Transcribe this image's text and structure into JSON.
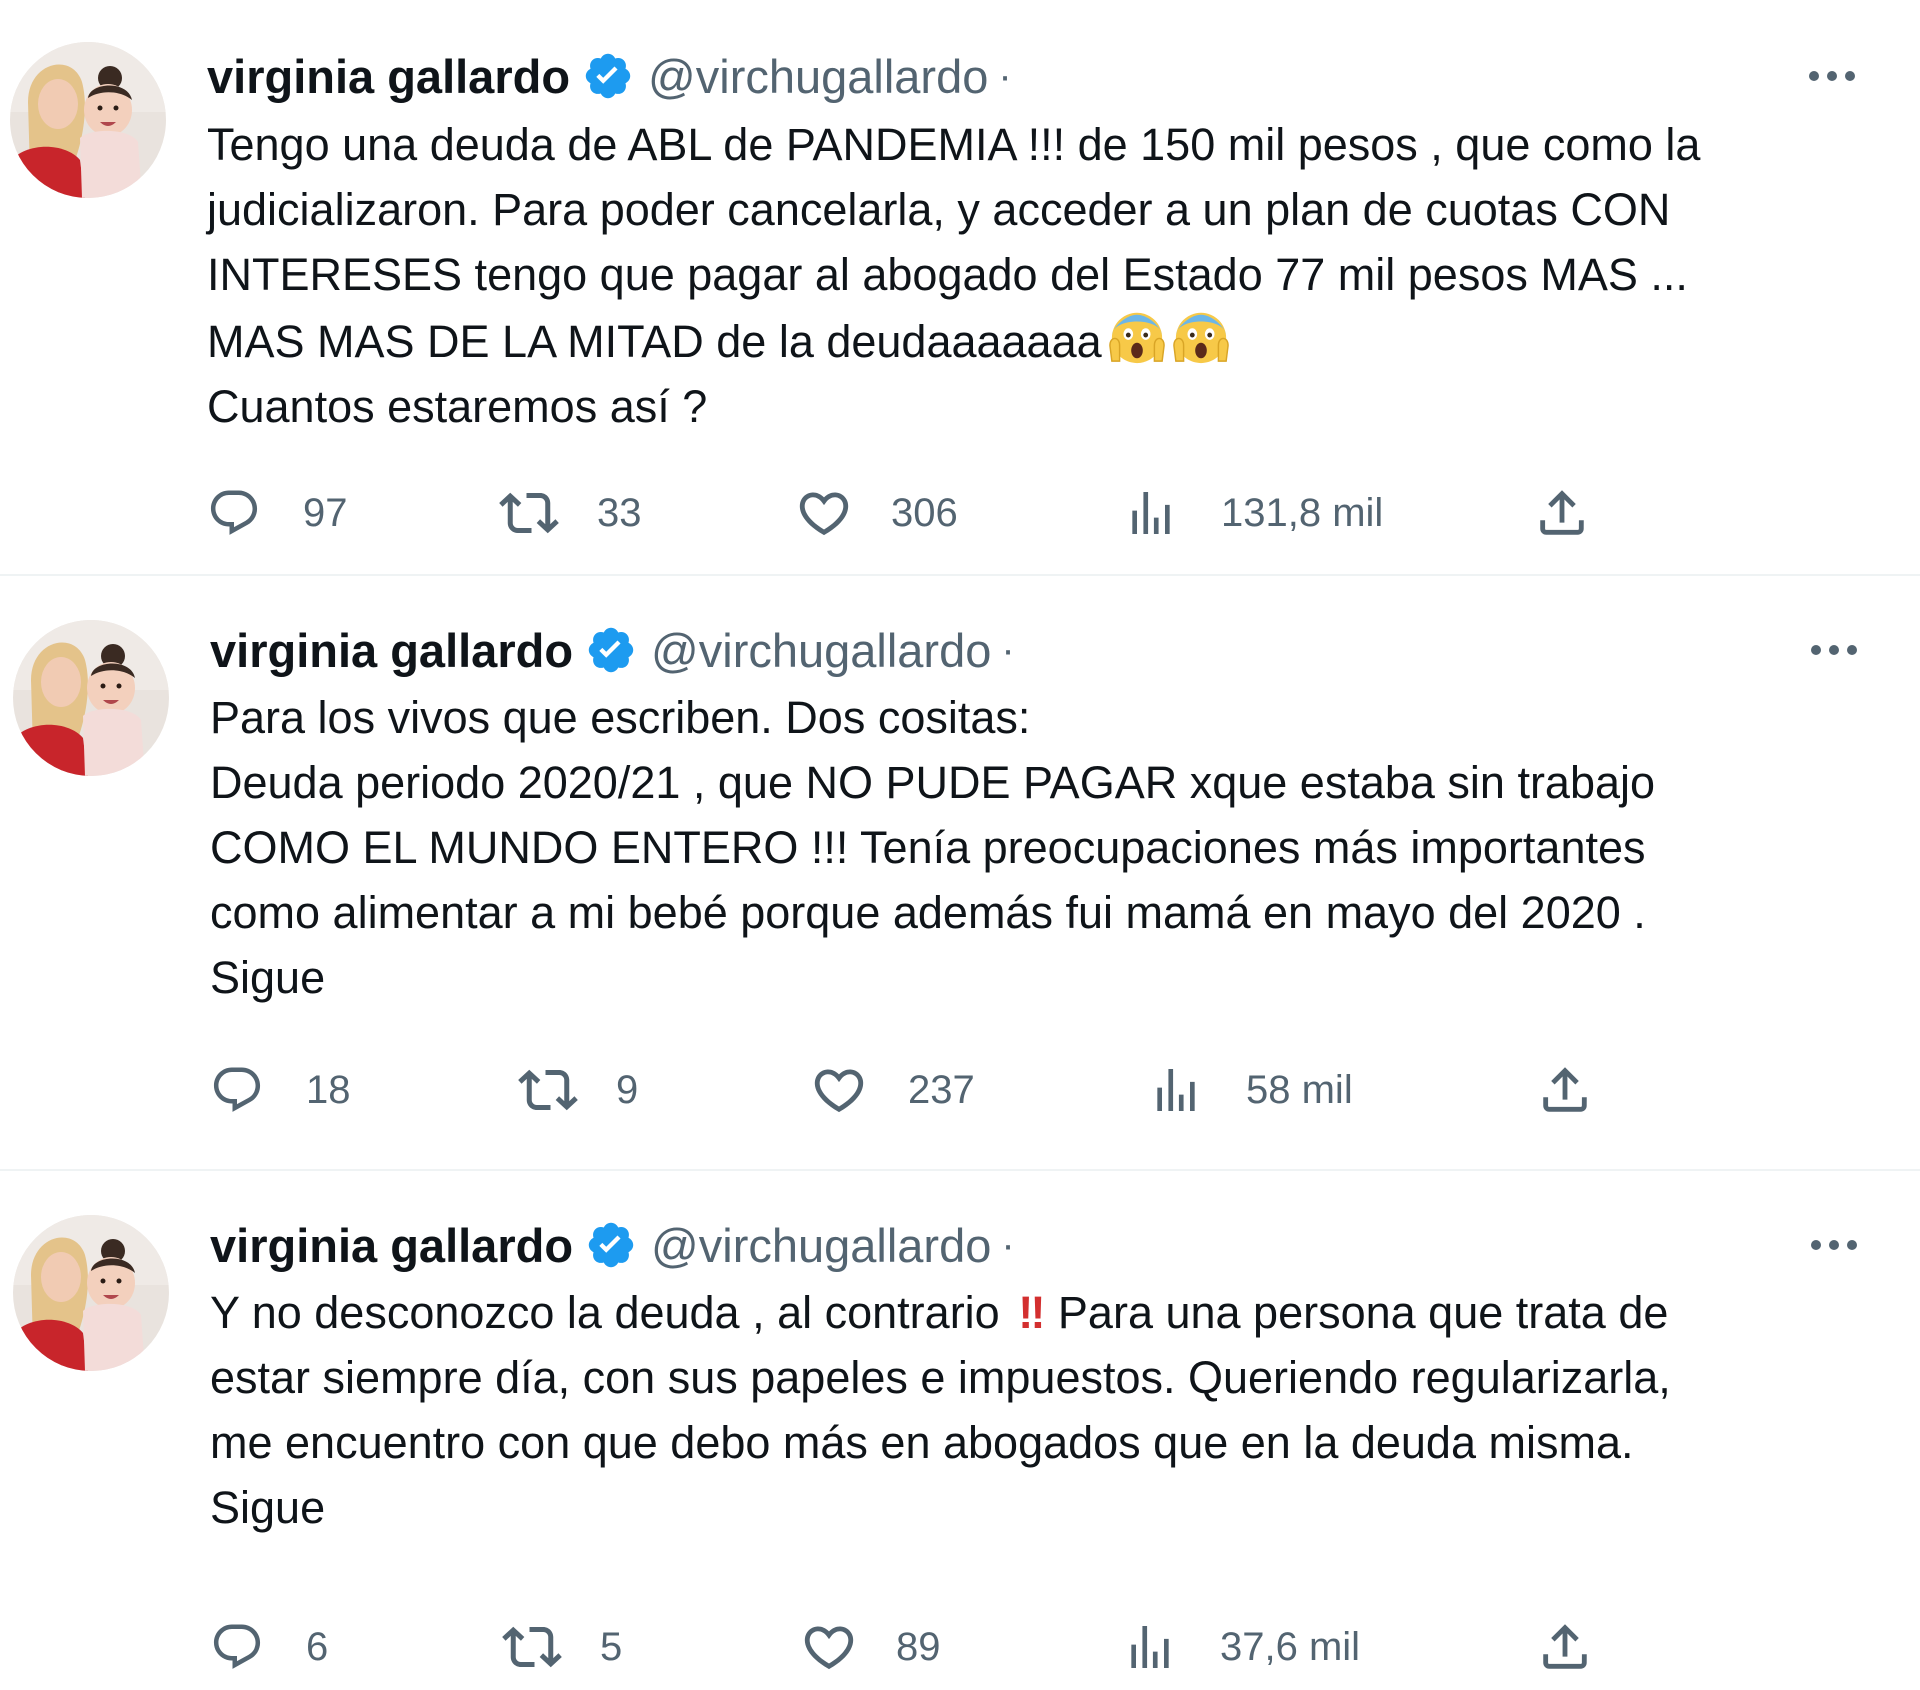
{
  "tweets": [
    {
      "author": {
        "name": "virginia gallardo",
        "handle": "@virchugallardo",
        "separator": "·"
      },
      "text_lines": [
        "Tengo una deuda de ABL de PANDEMIA !!! de 150 mil pesos , que como la",
        "judicializaron. Para poder cancelarla, y acceder a un plan de cuotas CON",
        "INTERESES tengo que pagar al abogado del Estado 77 mil pesos MAS ...",
        "MAS MAS DE LA MITAD de la deudaaaaaaa",
        "Cuantos estaremos así ?"
      ],
      "emoji": [
        "😱",
        "😱"
      ],
      "metrics": {
        "replies": "97",
        "retweets": "33",
        "likes": "306",
        "views": "131,8 mil"
      }
    },
    {
      "author": {
        "name": "virginia gallardo",
        "handle": "@virchugallardo",
        "separator": "·"
      },
      "text_lines": [
        "Para los vivos que escriben. Dos cositas:",
        "Deuda periodo 2020/21 , que NO PUDE PAGAR xque estaba sin trabajo",
        "COMO EL MUNDO ENTERO !!! Tenía preocupaciones más importantes",
        "como alimentar a mi bebé porque además fui mamá en mayo del 2020 .",
        "Sigue"
      ],
      "metrics": {
        "replies": "18",
        "retweets": "9",
        "likes": "237",
        "views": "58 mil"
      }
    },
    {
      "author": {
        "name": "virginia gallardo",
        "handle": "@virchugallardo",
        "separator": "·"
      },
      "text_lines": [
        "Y no desconozco la deuda , al contrario",
        "Para una persona que trata de",
        "estar siempre día, con sus papeles e impuestos. Queriendo regularizarla,",
        "me encuentro con que debo más en abogados que en la deuda misma.",
        "Sigue"
      ],
      "emoji_mark": "‼",
      "metrics": {
        "replies": "6",
        "retweets": "5",
        "likes": "89",
        "views": "37,6 mil"
      }
    }
  ],
  "icons": {
    "reply": "reply-icon",
    "retweet": "retweet-icon",
    "like": "heart-icon",
    "views": "views-icon",
    "share": "share-icon",
    "more": "more-icon",
    "verified": "verified-badge-icon"
  },
  "colors": {
    "text": "#0f1419",
    "secondary": "#536471",
    "verified": "#1d9bf0",
    "divider": "#eff3f4"
  }
}
